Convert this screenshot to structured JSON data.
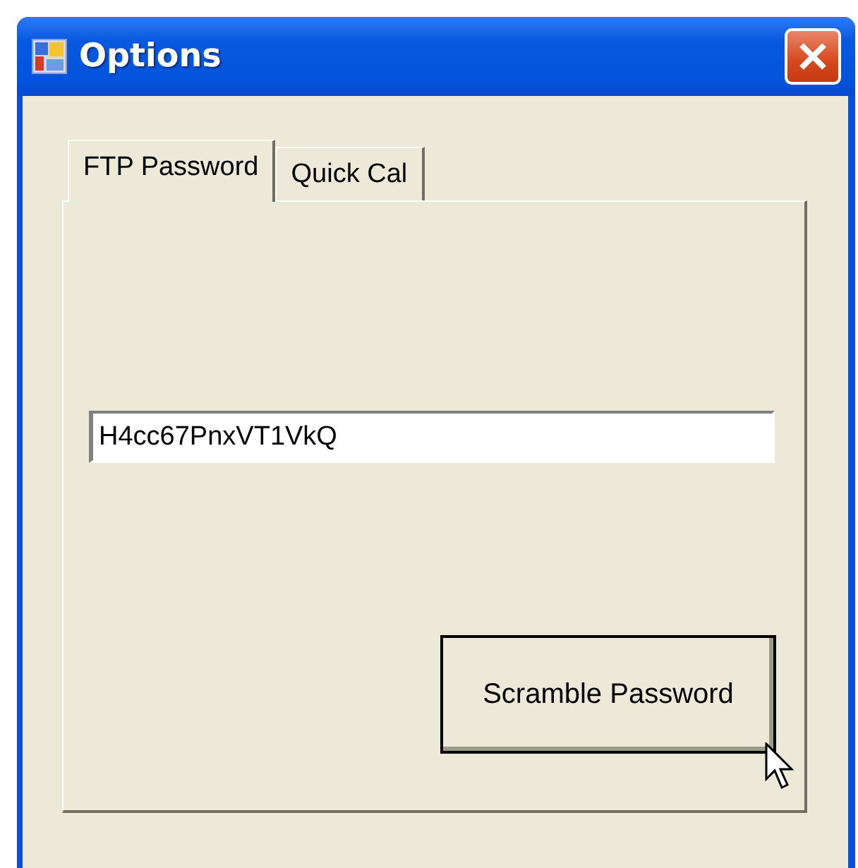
{
  "window": {
    "title": "Options"
  },
  "tabs": [
    {
      "label": "FTP Password",
      "selected": true
    },
    {
      "label": "Quick Cal",
      "selected": false
    }
  ],
  "password_field": {
    "value": "H4cc67PnxVT1VkQ"
  },
  "scramble_button": {
    "label": "Scramble Password"
  }
}
